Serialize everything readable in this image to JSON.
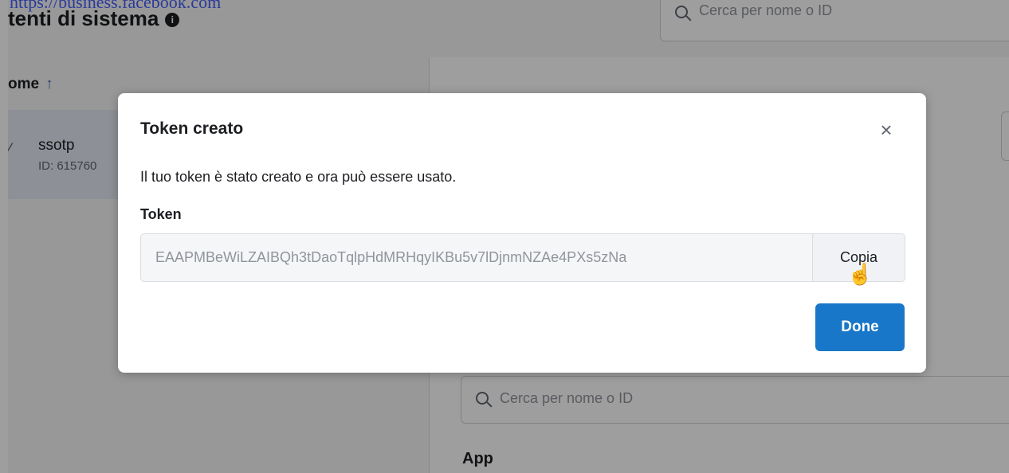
{
  "url": "https://business.facebook.com",
  "page": {
    "title": "tenti di sistema",
    "info_icon": "info-icon",
    "search_placeholder": "Cerca per nome o ID"
  },
  "list": {
    "column_header": "ome",
    "sort_icon": "↑",
    "selected_item": {
      "name": "ssotp",
      "id_text": "ID: 615760"
    }
  },
  "right_panel": {
    "search_placeholder": "Cerca per nome o ID",
    "section_title": "App"
  },
  "modal": {
    "title": "Token creato",
    "close_icon": "×",
    "description": "Il tuo token è stato creato e ora può essere usato.",
    "token_label": "Token",
    "token_value": "EAAPMBeWiLZAIBQh3tDaoTqlpHdMRHqyIKBu5v7lDjnmNZAe4PXs5zNa",
    "copy_label": "Copia",
    "done_label": "Done"
  }
}
